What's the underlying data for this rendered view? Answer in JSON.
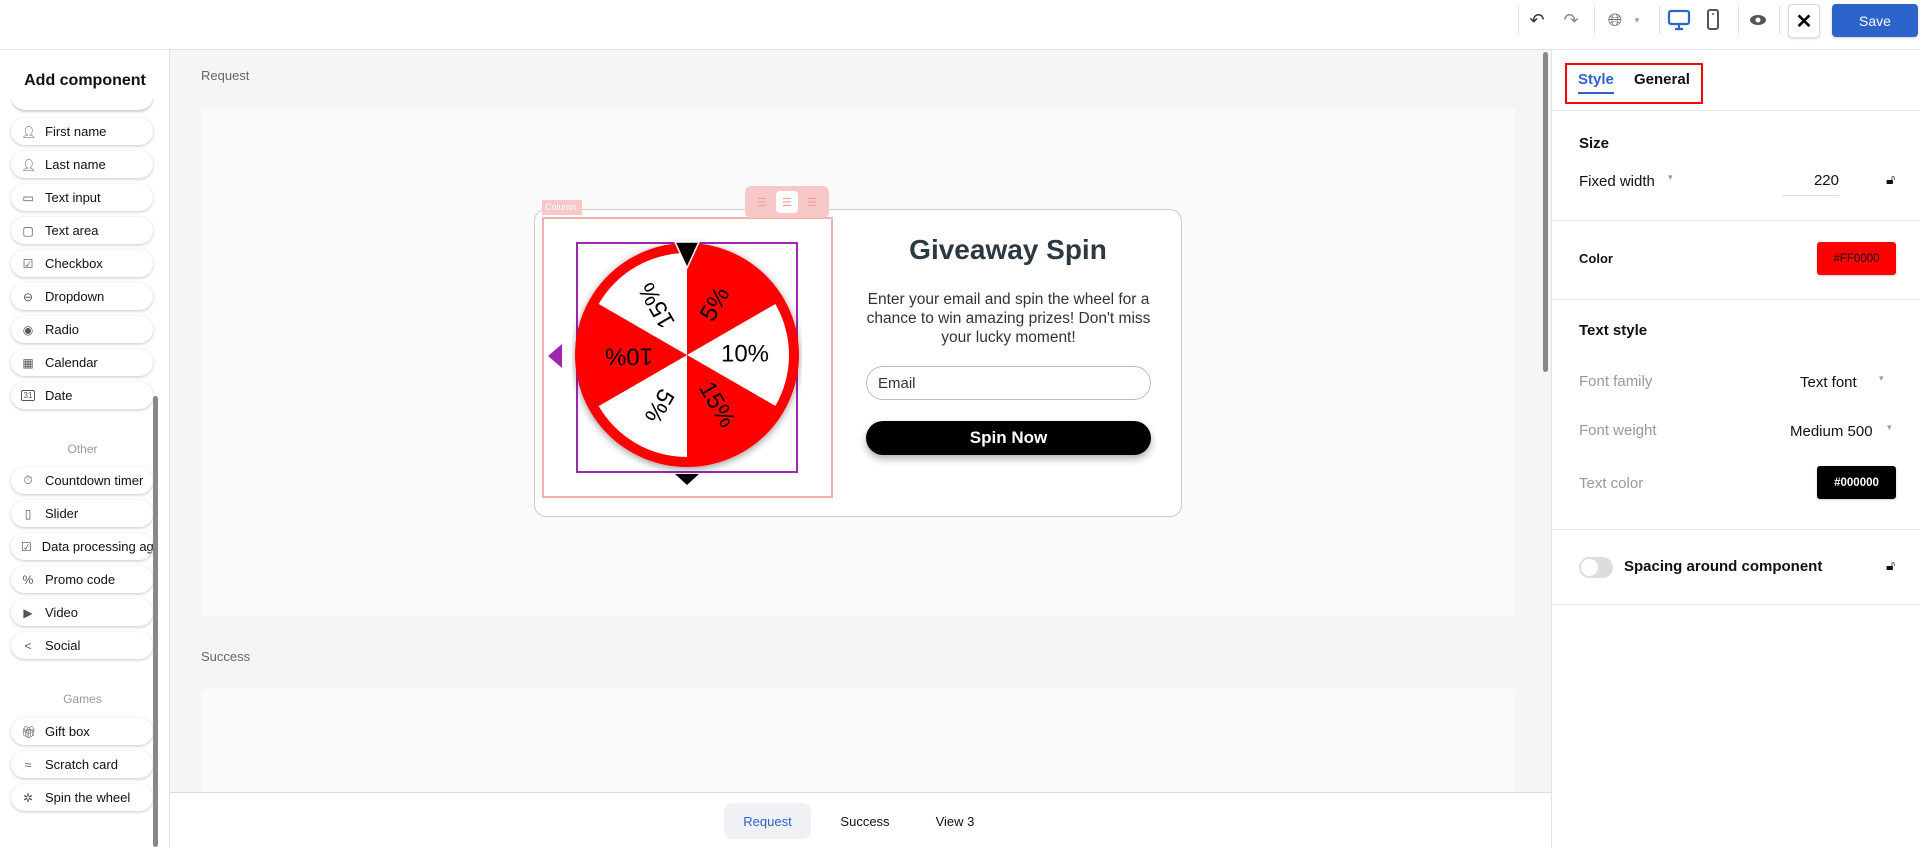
{
  "toolbar": {
    "save_label": "Save",
    "close_icon": "✕",
    "icons": [
      "undo-icon",
      "redo-icon",
      "globe-icon",
      "desktop-icon",
      "mobile-icon",
      "eye-icon"
    ],
    "accent": "#2c64cc"
  },
  "sidebar": {
    "title": "Add component",
    "items": [
      {
        "label": "First name",
        "icon": "person-icon"
      },
      {
        "label": "Last name",
        "icon": "person-icon"
      },
      {
        "label": "Text input",
        "icon": "text-input-icon"
      },
      {
        "label": "Text area",
        "icon": "text-area-icon"
      },
      {
        "label": "Checkbox",
        "icon": "checkbox-icon"
      },
      {
        "label": "Dropdown",
        "icon": "dropdown-icon"
      },
      {
        "label": "Radio",
        "icon": "radio-icon"
      },
      {
        "label": "Calendar",
        "icon": "calendar-icon"
      },
      {
        "label": "Date",
        "icon": "date-icon"
      }
    ],
    "other_label": "Other",
    "other_items": [
      {
        "label": "Countdown timer",
        "icon": "timer-icon"
      },
      {
        "label": "Slider",
        "icon": "slider-icon"
      },
      {
        "label": "Data processing agreement",
        "icon": "checkbox-icon"
      },
      {
        "label": "Promo code",
        "icon": "percent-icon"
      },
      {
        "label": "Video",
        "icon": "play-icon"
      },
      {
        "label": "Social",
        "icon": "share-icon"
      }
    ],
    "games_label": "Games",
    "games_items": [
      {
        "label": "Gift box",
        "icon": "gift-icon"
      },
      {
        "label": "Scratch card",
        "icon": "scratch-icon"
      },
      {
        "label": "Spin the wheel",
        "icon": "wheel-icon"
      }
    ]
  },
  "canvas": {
    "request_label": "Request",
    "success_label": "Success",
    "column_tag": "Column",
    "card": {
      "title": "Giveaway Spin",
      "description": "Enter your email and spin the wheel for a chance to win amazing prizes! Don't miss your lucky moment!",
      "email_placeholder": "Email",
      "button": "Spin Now"
    },
    "wheel": {
      "segments": [
        "5%",
        "10%",
        "15%",
        "5%",
        "10%",
        "15%"
      ],
      "colors": [
        "#ff0000",
        "#ffffff"
      ],
      "rim_color": "#ff0000"
    }
  },
  "bottom_tabs": [
    {
      "label": "Request",
      "active": true
    },
    {
      "label": "Success"
    },
    {
      "label": "View 3"
    }
  ],
  "panel": {
    "tabs": [
      {
        "label": "Style",
        "active": true
      },
      {
        "label": "General"
      }
    ],
    "size_title": "Size",
    "fixed_width_label": "Fixed width",
    "fixed_width_value": "220",
    "color_label": "Color",
    "color_value": "#FF0000",
    "text_style_title": "Text style",
    "font_family_label": "Font family",
    "font_family_value": "Text font",
    "font_weight_label": "Font weight",
    "font_weight_value": "Medium 500",
    "text_color_label": "Text color",
    "text_color_value": "#000000",
    "spacing_label": "Spacing around component",
    "spacing_enabled": false
  }
}
